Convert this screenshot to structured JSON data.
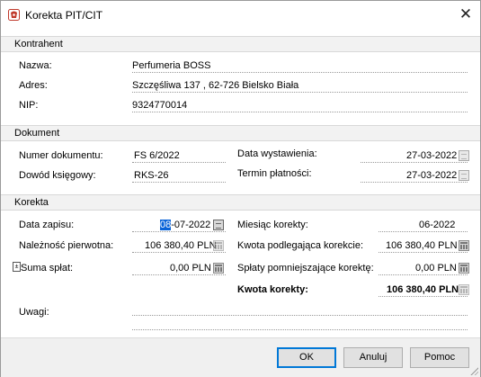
{
  "window": {
    "title": "Korekta PIT/CIT",
    "close_icon": "close-icon"
  },
  "kontrahent": {
    "header": "Kontrahent",
    "nazwa_label": "Nazwa:",
    "nazwa_value": "Perfumeria BOSS",
    "adres_label": "Adres:",
    "adres_value": "Szczęśliwa  137 , 62-726 Bielsko Biała",
    "nip_label": "NIP:",
    "nip_value": "9324770014"
  },
  "dokument": {
    "header": "Dokument",
    "numer_label": "Numer dokumentu:",
    "numer_value": "FS 6/2022",
    "dowod_label": "Dowód księgowy:",
    "dowod_value": "RKS-26",
    "data_wyst_label": "Data wystawienia:",
    "data_wyst_value": "27-03-2022",
    "termin_label": "Termin płatności:",
    "termin_value": "27-03-2022"
  },
  "korekta": {
    "header": "Korekta",
    "data_zapisu_label": "Data zapisu:",
    "data_zapisu_sel": "08",
    "data_zapisu_rest": "-07-2022",
    "naleznosc_label": "Należność pierwotna:",
    "naleznosc_value": "106 380,40 PLN",
    "suma_marker": "±",
    "suma_label": "Suma spłat:",
    "suma_value": "0,00 PLN",
    "miesiac_label": "Miesiąc korekty:",
    "miesiac_value": "06-2022",
    "kwota_podl_label": "Kwota podlegająca korekcie:",
    "kwota_podl_value": "106 380,40 PLN",
    "splaty_label": "Spłaty pomniejszające korektę:",
    "splaty_value": "0,00 PLN",
    "kwota_korekty_label": "Kwota korekty:",
    "kwota_korekty_value": "106 380,40 PLN",
    "uwagi_label": "Uwagi:"
  },
  "buttons": {
    "ok": "OK",
    "anuluj": "Anuluj",
    "pomoc": "Pomoc"
  },
  "colors": {
    "selection": "#0a64d8",
    "default_button_border": "#0078d7",
    "app_icon": "#c0392b"
  }
}
